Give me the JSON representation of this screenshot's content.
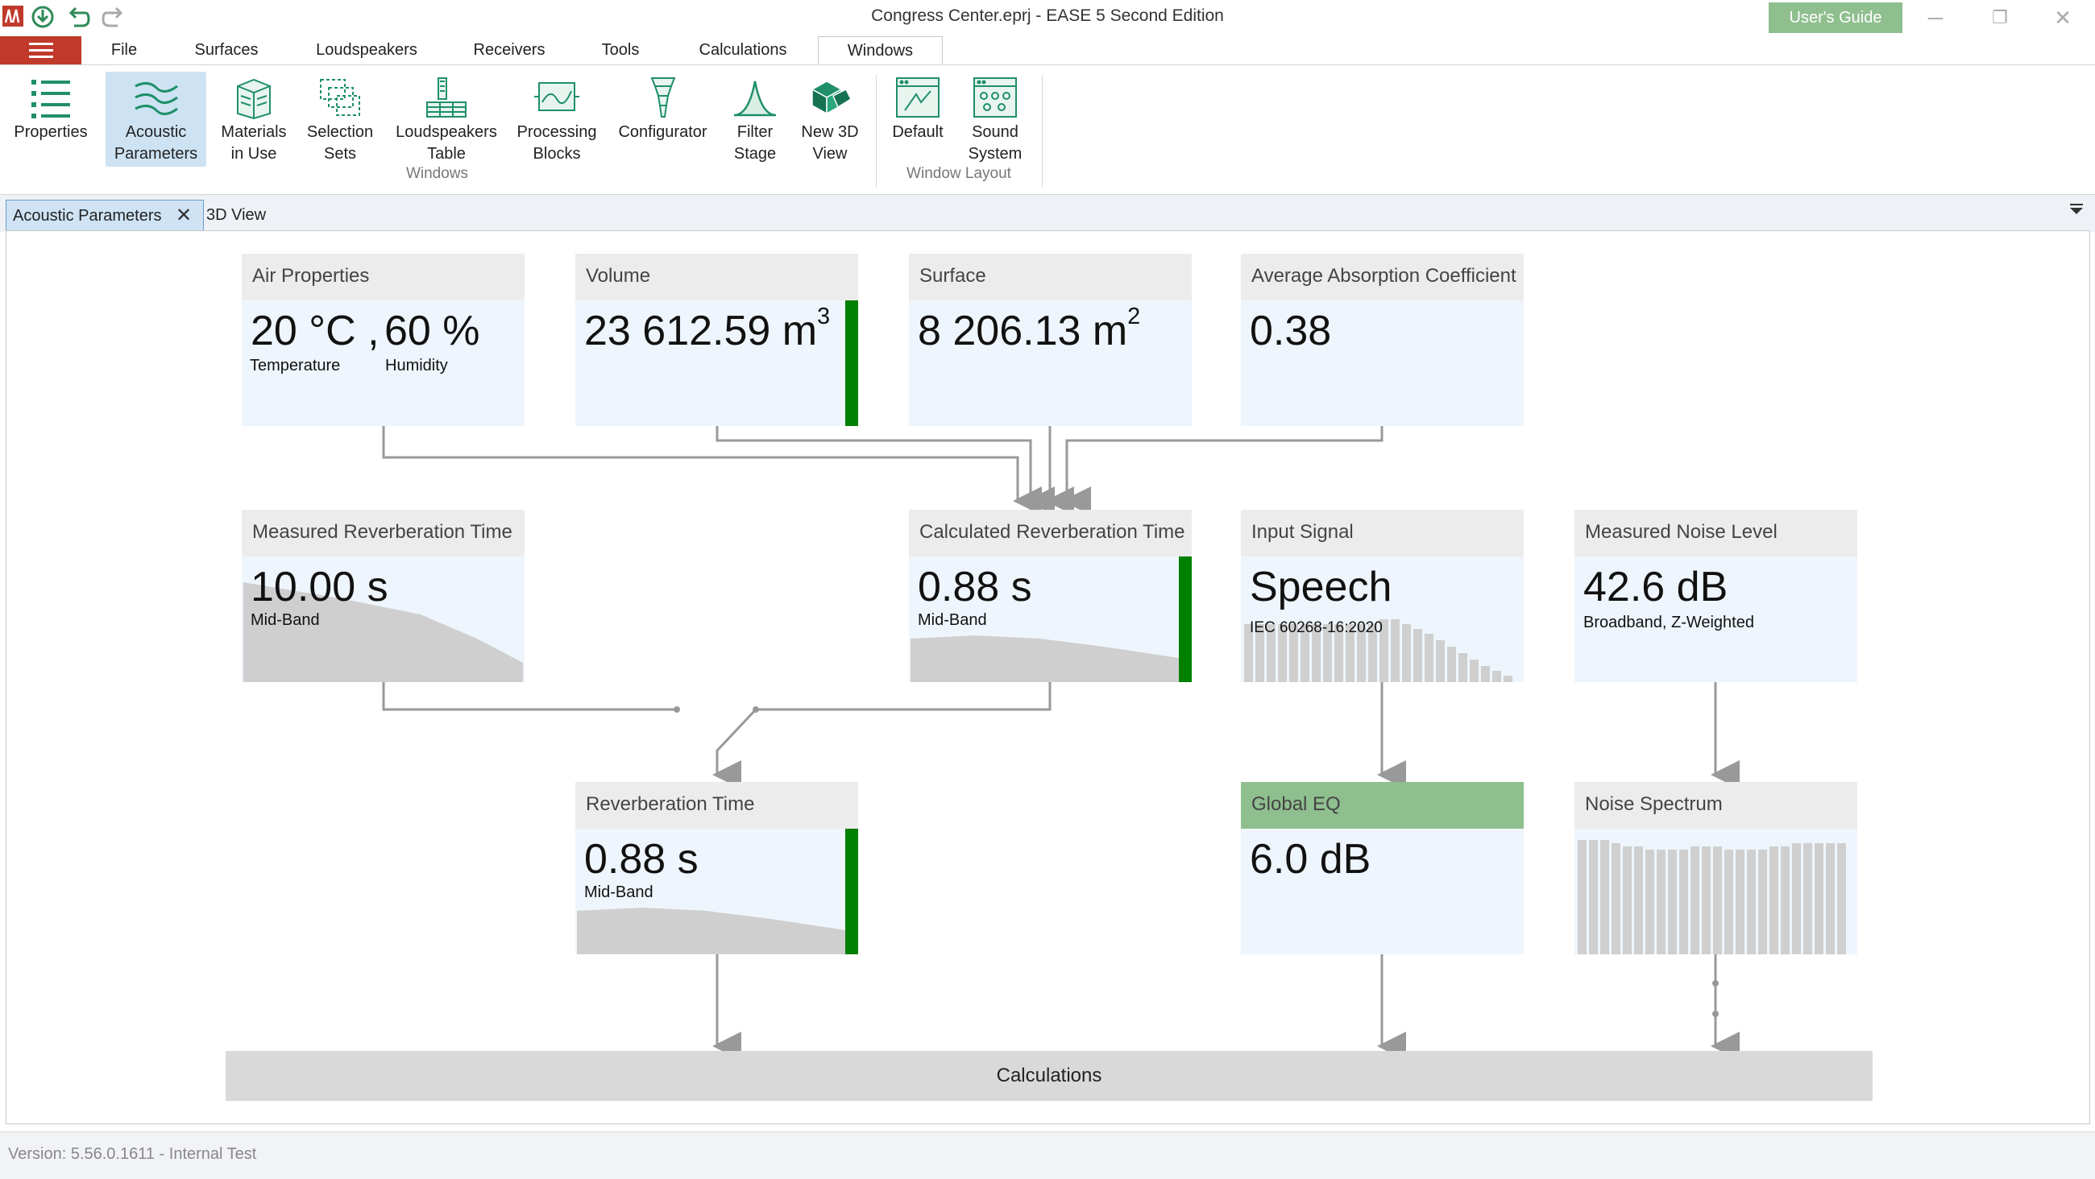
{
  "window": {
    "title": "Congress Center.eprj - EASE 5 Second Edition",
    "user_guide_label": "User's Guide",
    "minimize": "─",
    "restore": "❐",
    "close": "✕"
  },
  "quick_access": [
    "app-logo-icon",
    "save-icon",
    "undo-icon",
    "redo-icon"
  ],
  "menu": {
    "tabs": [
      {
        "label": "File"
      },
      {
        "label": "Surfaces"
      },
      {
        "label": "Loudspeakers"
      },
      {
        "label": "Receivers"
      },
      {
        "label": "Tools"
      },
      {
        "label": "Calculations"
      },
      {
        "label": "Windows",
        "active": true
      }
    ]
  },
  "ribbon": {
    "buttons": [
      {
        "label": "Properties",
        "icon": "properties-list-icon"
      },
      {
        "label": "Acoustic\nParameters",
        "icon": "acoustic-parameters-icon",
        "selected": true
      },
      {
        "label": "Materials\nin Use",
        "icon": "materials-icon"
      },
      {
        "label": "Selection\nSets",
        "icon": "selection-sets-icon"
      },
      {
        "label": "Loudspeakers\nTable",
        "icon": "loudspeakers-table-icon"
      },
      {
        "label": "Processing\nBlocks",
        "icon": "processing-blocks-icon"
      },
      {
        "label": "Configurator",
        "icon": "configurator-icon"
      },
      {
        "label": "Filter\nStage",
        "icon": "filter-stage-icon"
      },
      {
        "label": "New 3D\nView",
        "icon": "new-3d-view-icon"
      },
      {
        "label": "Default",
        "icon": "default-layout-icon"
      },
      {
        "label": "Sound\nSystem",
        "icon": "sound-system-icon"
      }
    ],
    "groups": [
      {
        "label": "Windows"
      },
      {
        "label": "Window Layout"
      }
    ]
  },
  "doc_tabs": [
    {
      "label": "Acoustic Parameters",
      "active": true
    },
    {
      "label": "3D View"
    }
  ],
  "nodes": {
    "air_properties": {
      "title": "Air Properties",
      "temperature": "20 °C ,",
      "humidity": "60 %",
      "temperature_label": "Temperature",
      "humidity_label": "Humidity"
    },
    "volume": {
      "title": "Volume",
      "value": "23 612.59 m",
      "unit_exp": "3"
    },
    "surface": {
      "title": "Surface",
      "value": "8 206.13 m",
      "unit_exp": "2"
    },
    "avg_absorption": {
      "title": "Average Absorption Coefficient",
      "value": "0.38"
    },
    "measured_rt": {
      "title": "Measured Reverberation Time",
      "value": "10.00  s",
      "sub": "Mid-Band"
    },
    "calculated_rt": {
      "title": "Calculated Reverberation Time",
      "value": "0.88  s",
      "sub": "Mid-Band"
    },
    "input_signal": {
      "title": "Input Signal",
      "value": "Speech",
      "sub": "IEC 60268-16:2020"
    },
    "measured_noise": {
      "title": "Measured Noise Level",
      "value": "42.6  dB",
      "sub": "Broadband, Z-Weighted"
    },
    "reverberation_time": {
      "title": "Reverberation Time",
      "value": "0.88  s",
      "sub": "Mid-Band"
    },
    "global_eq": {
      "title": "Global EQ",
      "value": "6.0  dB"
    },
    "noise_spectrum": {
      "title": "Noise Spectrum"
    }
  },
  "calculations_label": "Calculations",
  "status": {
    "version": "Version: 5.56.0.1611 - Internal Test"
  },
  "colors": {
    "accent_green": "#008000",
    "header_green": "#8fbf8f",
    "menu_red": "#c0392b",
    "node_bg": "#eef5fc"
  }
}
